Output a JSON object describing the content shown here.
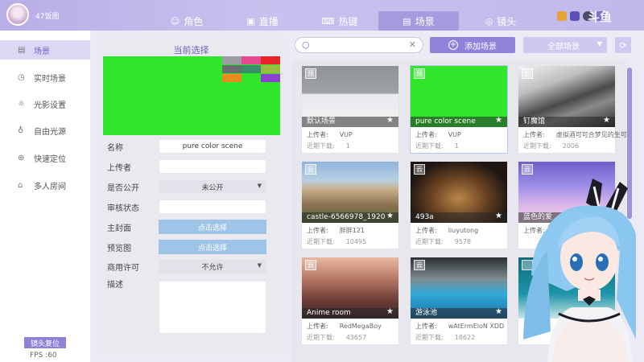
{
  "app": {
    "name": "47饭图",
    "logo_text": "斗鱼"
  },
  "tabs": [
    {
      "label": "角色",
      "icon": "person-icon"
    },
    {
      "label": "直播",
      "icon": "live-icon"
    },
    {
      "label": "热键",
      "icon": "keyboard-icon"
    },
    {
      "label": "场景",
      "icon": "image-icon",
      "active": true
    },
    {
      "label": "镜头",
      "icon": "camera-icon"
    }
  ],
  "sidebar": {
    "items": [
      {
        "label": "场景",
        "icon": "image-icon",
        "active": true
      },
      {
        "label": "实时场景",
        "icon": "clock-icon"
      },
      {
        "label": "光影设置",
        "icon": "light-icon"
      },
      {
        "label": "自由光源",
        "icon": "bulb-icon"
      },
      {
        "label": "快速定位",
        "icon": "target-icon"
      },
      {
        "label": "多人房间",
        "icon": "home-icon"
      }
    ],
    "reset_button": "镜头复位",
    "fps": "FPS :60"
  },
  "properties": {
    "title": "当前选择",
    "preview_color": "#2fe62a",
    "swatches": [
      "#9a9ea3",
      "#e84a8f",
      "#e8242a",
      "#6a6e73",
      "#3a8f6b",
      "#9bbd3f",
      "#f08a1f",
      "#8e3fd3",
      "#6b2fd8"
    ],
    "name_label": "名称",
    "name_value": "pure color scene",
    "uploader_label": "上传者",
    "uploader_value": "",
    "public_label": "是否公开",
    "public_value": "未公开",
    "review_label": "审核状态",
    "review_value": "",
    "cover_label": "主封面",
    "cover_button": "点击选择",
    "preview_label": "预览图",
    "preview_button": "点击选择",
    "commercial_label": "商用许可",
    "commercial_value": "不允许",
    "desc_label": "描述",
    "desc_value": ""
  },
  "toolbar": {
    "search_placeholder": "",
    "add_button": "添加场景",
    "filter_value": "全部场景"
  },
  "uploader_prefix": "上传者:",
  "downloads_prefix": "近期下载:",
  "scenes": [
    {
      "badge": "预",
      "name": "默认场景",
      "uploader": "VUP",
      "downloads": "1"
    },
    {
      "badge": "预",
      "name": "pure color scene",
      "uploader": "VUP",
      "downloads": "1",
      "selected": true
    },
    {
      "badge": "云",
      "name": "钉魔馆",
      "uploader": "虚拟酒可可合梦见的生可",
      "downloads": "2006"
    },
    {
      "badge": "云",
      "name": "castle-6566978_1920",
      "uploader": "胖胖121",
      "downloads": "10495"
    },
    {
      "badge": "云",
      "name": "493a",
      "uploader": "liuyutong",
      "downloads": "9578"
    },
    {
      "badge": "云",
      "name": "蓝色的爱",
      "uploader": "",
      "downloads": ""
    },
    {
      "badge": "云",
      "name": "Anime room",
      "uploader": "RedMegaBoy",
      "downloads": "43657"
    },
    {
      "badge": "云",
      "name": "游泳池",
      "uploader": "wAtErmEloN XDD",
      "downloads": "18622"
    },
    {
      "badge": "",
      "name": "",
      "uploader": "",
      "downloads": ""
    }
  ]
}
